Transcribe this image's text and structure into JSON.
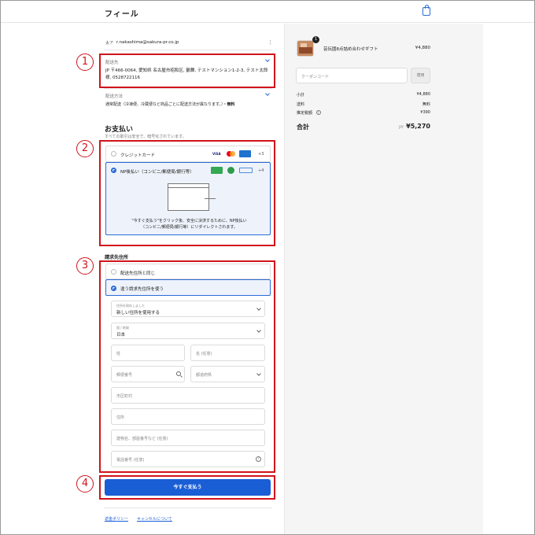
{
  "header": {
    "brand": "フィール",
    "cart_icon": "shopping-bag-icon"
  },
  "account": {
    "label": "太ア",
    "email": "r.nakashima@sakura-pr.co.jp",
    "menu_icon": "more-vertical-icon"
  },
  "shipping": {
    "ship_to_label": "配送先",
    "ship_to_value": "JP 〒466-0064, 愛知県 名古屋市昭和区, 鶴舞, テストマンション1-2-3, テスト太郎様, 0528722116",
    "method_label": "配送方法",
    "method_value": "通常配送（冷凍便、冷蔵便など商品ごとに配送方法が異なります。）",
    "method_price": "・無料"
  },
  "payment": {
    "title": "お支払い",
    "subtitle": "すべての取引は安全で、暗号化されています。",
    "option_credit": "クレジットカード",
    "credit_more": "+3",
    "credit_icons": [
      "VISA",
      "MC",
      "AMEX"
    ],
    "option_np": "NP後払い（コンビニ/郵便局/銀行等）",
    "np_more": "+4",
    "redirect_text": "\"今すぐ支払う\"をクリック後、安全に決済するために、NP後払い（コンビニ/郵便局/銀行等）にリダイレクトされます。"
  },
  "billing": {
    "title": "請求先住所",
    "opt_same": "配送先住所と同じ",
    "opt_diff": "違う請求先住所を使う",
    "saved_label": "住所を保存しました",
    "saved_value": "新しい住所を使用する",
    "country_label": "国 / 地域",
    "country_value": "日本",
    "last_name_ph": "姓",
    "first_name_ph": "名 (任意)",
    "postal_ph": "郵便番号",
    "pref_ph": "都道府県",
    "city_ph": "市区町村",
    "address_ph": "住所",
    "building_ph": "建物名、部屋番号など (任意)",
    "phone_ph": "電話番号 (任意)"
  },
  "pay_button": "今すぐ支払う",
  "footer": {
    "refund": "返金ポリシー",
    "cancel": "キャンセルについて"
  },
  "annotations": [
    "1",
    "2",
    "3",
    "4"
  ],
  "summary": {
    "item_name": "芸伝囲8点詰め合わせギフト",
    "item_qty": "1",
    "item_price": "¥4,880",
    "coupon_ph": "クーポンコード",
    "apply": "適用",
    "subtotal_label": "小計",
    "subtotal": "¥4,880",
    "shipping_label": "送料",
    "shipping": "無料",
    "tax_label": "推定税額",
    "tax": "¥390",
    "total_label": "合計",
    "currency": "JPY",
    "total": "¥5,270"
  },
  "colors": {
    "accent": "#1a5ed6",
    "annotation": "#d0141b"
  }
}
